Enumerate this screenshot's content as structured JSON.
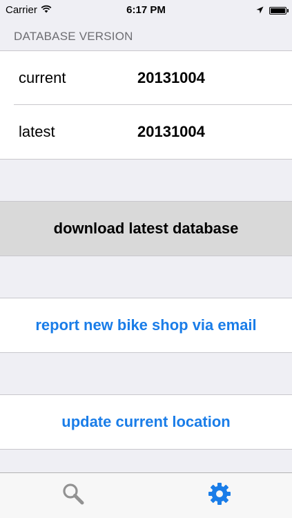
{
  "status_bar": {
    "carrier": "Carrier",
    "time": "6:17 PM",
    "wifi_icon": "wifi-icon",
    "location_icon": "location-arrow-icon",
    "battery_icon": "battery-icon",
    "battery_level_percent": 100
  },
  "settings": {
    "section_header": "DATABASE VERSION",
    "rows": [
      {
        "label": "current",
        "value": "20131004"
      },
      {
        "label": "latest",
        "value": "20131004"
      }
    ],
    "download_button": "download latest database",
    "report_button": "report new bike shop via email",
    "update_location_button": "update current location"
  },
  "tab_bar": {
    "tabs": [
      {
        "icon": "search-icon",
        "selected": false
      },
      {
        "icon": "gear-icon",
        "selected": true
      }
    ]
  },
  "colors": {
    "background": "#efeff4",
    "accent_blue": "#1a7de8",
    "inactive_icon": "#929292",
    "download_bg": "#d9d9d9"
  }
}
